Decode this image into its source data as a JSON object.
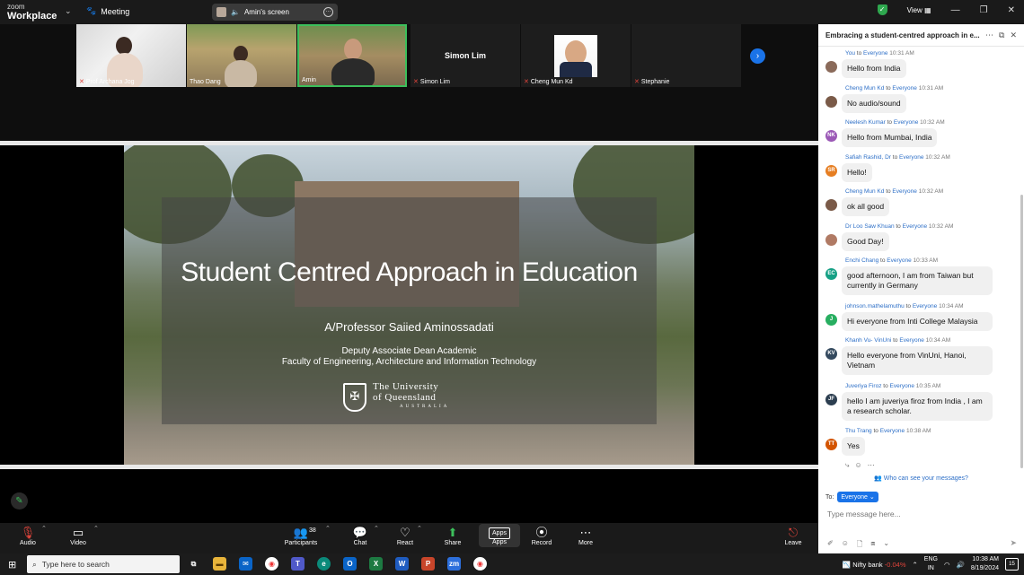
{
  "titlebar": {
    "logo_line1": "zoom",
    "logo_line2": "Workplace",
    "meeting_label": "Meeting",
    "screen_share_label": "Amin's screen",
    "view_label": "View"
  },
  "gallery": {
    "participants": [
      {
        "name": "Prof Archana Jog",
        "muted": true
      },
      {
        "name": "Thao Dang",
        "muted": false
      },
      {
        "name": "Amin",
        "muted": false,
        "active_speaker": true
      },
      {
        "name": "Simon Lim",
        "muted": true,
        "center_name": "Simon Lim"
      },
      {
        "name": "Cheng Mun Kd",
        "muted": true
      },
      {
        "name": "Stephanie",
        "muted": true
      }
    ]
  },
  "slide": {
    "title": "Student Centred Approach in Education",
    "author": "A/Professor Saiied Aminossadati",
    "role1": "Deputy Associate Dean Academic",
    "role2": "Faculty of Engineering, Architecture and Information Technology",
    "uni_line1": "The University",
    "uni_line2": "of Queensland",
    "uni_line3": "AUSTRALIA"
  },
  "toolbar": {
    "audio": "Audio",
    "video": "Video",
    "participants": "Participants",
    "participants_count": "38",
    "chat": "Chat",
    "react": "React",
    "share": "Share",
    "apps_box": "Apps",
    "apps": "Apps",
    "record": "Record",
    "more": "More",
    "leave": "Leave"
  },
  "chat": {
    "title": "Embracing a student-centred approach in e...",
    "to_word": "to",
    "messages": [
      {
        "sender": "You",
        "to": "Everyone",
        "time": "10:31 AM",
        "text": "Hello from India",
        "avatar": "",
        "color": "#8a6a5a"
      },
      {
        "sender": "Cheng Mun Kd",
        "to": "Everyone",
        "time": "10:31 AM",
        "text": "No audio/sound",
        "avatar": "",
        "color": "#7a5a48"
      },
      {
        "sender": "Neelesh Kumar",
        "to": "Everyone",
        "time": "10:32 AM",
        "text": "Hello from Mumbai, India",
        "avatar": "NK",
        "color": "#9b59b6"
      },
      {
        "sender": "Safiah Rashid, Dr",
        "to": "Everyone",
        "time": "10:32 AM",
        "text": "Hello!",
        "avatar": "SR",
        "color": "#e67e22"
      },
      {
        "sender": "Cheng Mun Kd",
        "to": "Everyone",
        "time": "10:32 AM",
        "text": "ok all good",
        "avatar": "",
        "color": "#7a5a48"
      },
      {
        "sender": "Dr Loo Saw Khuan",
        "to": "Everyone",
        "time": "10:32 AM",
        "text": "Good Day!",
        "avatar": "",
        "color": "#b07a64"
      },
      {
        "sender": "Enchi Chang",
        "to": "Everyone",
        "time": "10:33 AM",
        "text": "good afternoon, I am from Taiwan but currently in Germany",
        "avatar": "EC",
        "color": "#16a085"
      },
      {
        "sender": "johnson.mathelamuthu",
        "to": "Everyone",
        "time": "10:34 AM",
        "text": "Hi everyone from Inti College Malaysia",
        "avatar": "J",
        "color": "#27ae60"
      },
      {
        "sender": "Khanh Vu- VinUni",
        "to": "Everyone",
        "time": "10:34 AM",
        "text": "Hello everyone from VinUni, Hanoi, Vietnam",
        "avatar": "KV",
        "color": "#34495e"
      },
      {
        "sender": "Juveriya Firoz",
        "to": "Everyone",
        "time": "10:35 AM",
        "text": "hello I am juveriya firoz from India , I am a research scholar.",
        "avatar": "JF",
        "color": "#2c3e50"
      },
      {
        "sender": "Thu Trang",
        "to": "Everyone",
        "time": "10:38 AM",
        "text": "Yes",
        "avatar": "TT",
        "color": "#d35400"
      }
    ],
    "who_can_see": "Who can see your messages?",
    "to_label": "To:",
    "recipient": "Everyone",
    "input_placeholder": "Type message here..."
  },
  "taskbar": {
    "search_placeholder": "Type here to search",
    "stock_name": "Nifty bank",
    "stock_change": "-0.04%",
    "lang1": "ENG",
    "lang2": "IN",
    "time": "10:38 AM",
    "date": "8/19/2024",
    "notifications": "15"
  },
  "colors": {
    "accent": "#1a73e8",
    "active_speaker": "#3cbf5b",
    "muted": "#e0443b"
  }
}
